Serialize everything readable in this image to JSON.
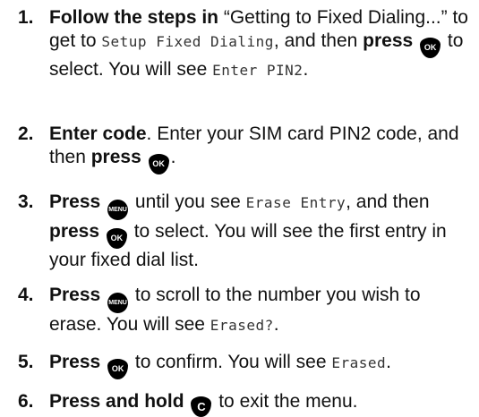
{
  "icons": {
    "ok": "OK",
    "menu": "MENU",
    "c": "C"
  },
  "steps": [
    {
      "num": "1.",
      "bold1": "Follow the steps in",
      "t1": " “Getting to Fixed Dialing...” to get to ",
      "lcd1": "Setup Fixed Dialing",
      "t2": ", and then ",
      "bold2": "press",
      "t3": " to select. You will see ",
      "lcd2": "Enter PIN2",
      "t4": "."
    },
    {
      "num": "2.",
      "bold1": "Enter code",
      "t1": ". Enter your SIM card PIN2 code, and then ",
      "bold2": "press",
      "t2": "."
    },
    {
      "num": "3.",
      "bold1": "Press",
      "t1": " until you see ",
      "lcd1": "Erase Entry",
      "t2": ", and then ",
      "bold2": "press",
      "t3": " to select. You will see the first entry in your fixed dial list."
    },
    {
      "num": "4.",
      "bold1": "Press",
      "t1": " to scroll to the number you wish to erase. You will see ",
      "lcd1": "Erased?",
      "t2": "."
    },
    {
      "num": "5.",
      "bold1": "Press",
      "t1": " to confirm. You will see ",
      "lcd1": "Erased",
      "t2": "."
    },
    {
      "num": "6.",
      "bold1": "Press and hold",
      "t1": " to exit the menu."
    }
  ]
}
